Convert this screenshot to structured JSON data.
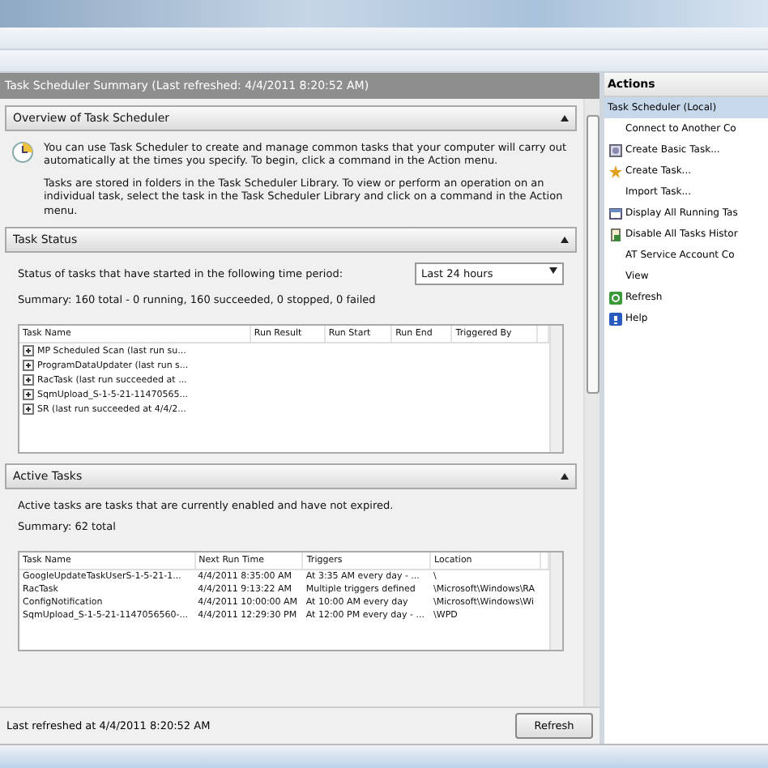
{
  "summary_header": "Task Scheduler Summary (Last refreshed: 4/4/2011 8:20:52 AM)",
  "overview": {
    "title": "Overview of Task Scheduler",
    "expanded": true,
    "paragraphs": [
      "You can use Task Scheduler to create and manage common tasks that your computer will carry out automatically at the times you specify. To begin, click a command in the Action menu.",
      "Tasks are stored in folders in the Task Scheduler Library. To view or perform an operation on an individual task, select the task in the Task Scheduler Library and click on a command in the Action menu."
    ]
  },
  "task_status": {
    "title": "Task Status",
    "expanded": true,
    "prompt": "Status of tasks that have started in the following time period:",
    "period": "Last 24 hours",
    "summary": "Summary: 160 total - 0 running, 160 succeeded, 0 stopped, 0 failed",
    "table": {
      "columns": [
        "Task Name",
        "Run Result",
        "Run Start",
        "Run End",
        "Triggered By"
      ],
      "rows": [
        {
          "cells": [
            "MP Scheduled Scan (last run su..."
          ],
          "expanded": false
        },
        {
          "cells": [
            "ProgramDataUpdater (last run s..."
          ],
          "expanded": false
        },
        {
          "cells": [
            "RacTask (last run succeeded at ..."
          ],
          "expanded": false
        },
        {
          "cells": [
            "SqmUpload_S-1-5-21-11470565..."
          ],
          "expanded": false
        },
        {
          "cells": [
            "SR (last run succeeded at 4/4/2..."
          ],
          "expanded": false
        }
      ]
    }
  },
  "active_tasks": {
    "title": "Active Tasks",
    "expanded": true,
    "description": "Active tasks are tasks that are currently enabled and have not expired.",
    "summary": "Summary: 62 total",
    "table": {
      "columns": [
        "Task Name",
        "Next Run Time",
        "Triggers",
        "Location"
      ],
      "rows": [
        {
          "cells": [
            "GoogleUpdateTaskUserS-1-5-21-1...",
            "4/4/2011 8:35:00 AM",
            "At 3:35 AM every day - ...",
            "\\"
          ]
        },
        {
          "cells": [
            "RacTask",
            "4/4/2011 9:13:22 AM",
            "Multiple triggers defined",
            "\\Microsoft\\Windows\\RA"
          ]
        },
        {
          "cells": [
            "ConfigNotification",
            "4/4/2011 10:00:00 AM",
            "At 10:00 AM every day",
            "\\Microsoft\\Windows\\Wi"
          ]
        },
        {
          "cells": [
            "SqmUpload_S-1-5-21-1147056560-...",
            "4/4/2011 12:29:30 PM",
            "At 12:00 PM every day - ...",
            "\\WPD"
          ]
        }
      ]
    }
  },
  "footer": {
    "text": "Last refreshed at 4/4/2011 8:20:52 AM",
    "button": "Refresh"
  },
  "actions": {
    "title": "Actions",
    "items": [
      {
        "label": "Task Scheduler (Local)",
        "kind": "group",
        "selected": true
      },
      {
        "label": "Connect to Another Co",
        "kind": "action",
        "selected": false
      },
      {
        "label": "Create Basic Task...",
        "kind": "action",
        "selected": false
      },
      {
        "label": "Create Task...",
        "kind": "action",
        "selected": false
      },
      {
        "label": "Import Task...",
        "kind": "action",
        "selected": false
      },
      {
        "label": "Display All Running Tas",
        "kind": "action",
        "selected": false
      },
      {
        "label": "Disable All Tasks Histor",
        "kind": "action",
        "selected": false
      },
      {
        "label": "AT Service Account Co",
        "kind": "action",
        "selected": false
      },
      {
        "label": "View",
        "kind": "action",
        "selected": false
      },
      {
        "label": "Refresh",
        "kind": "action",
        "selected": false
      },
      {
        "label": "Help",
        "kind": "action",
        "selected": false
      }
    ]
  }
}
